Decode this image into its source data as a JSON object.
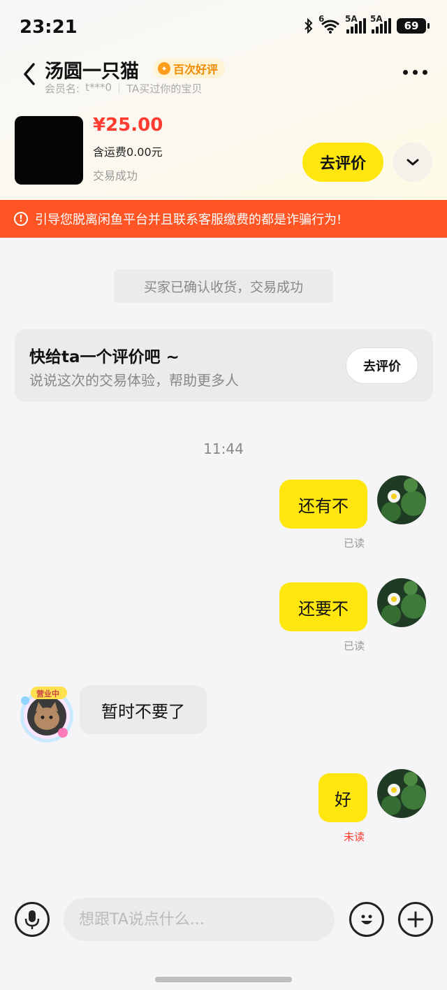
{
  "status_bar": {
    "time": "23:21",
    "wifi_label": "6",
    "signal1_label": "5A",
    "signal2_label": "5A",
    "battery": "69"
  },
  "header": {
    "title": "汤圆一只猫",
    "badge": "百次好评",
    "member_label": "会员名:",
    "member_name": "t***0",
    "bought_note": "TA买过你的宝贝"
  },
  "product": {
    "price": "¥25.00",
    "shipping": "含运费0.00元",
    "status": "交易成功",
    "review_button": "去评价"
  },
  "warning": {
    "text": "引导您脱离闲鱼平台并且联系客服缴费的都是诈骗行为!"
  },
  "chat": {
    "system_notice": "买家已确认收货，交易成功",
    "rating_card": {
      "title": "快给ta一个评价吧 ~",
      "subtitle": "说说这次的交易体验，帮助更多人",
      "button": "去评价"
    },
    "timestamp": "11:44",
    "messages": [
      {
        "sender": "me",
        "text": "还有不",
        "status": "已读"
      },
      {
        "sender": "me",
        "text": "还要不",
        "status": "已读"
      },
      {
        "sender": "other",
        "text": "暂时不要了",
        "avatar_tag": "营业中"
      },
      {
        "sender": "me",
        "text": "好",
        "status": "未读"
      }
    ]
  },
  "input": {
    "placeholder": "想跟TA说点什么..."
  },
  "colors": {
    "accent_yellow": "#ffe60f",
    "warning_orange": "#ff5524",
    "price_red": "#ff3b30"
  }
}
